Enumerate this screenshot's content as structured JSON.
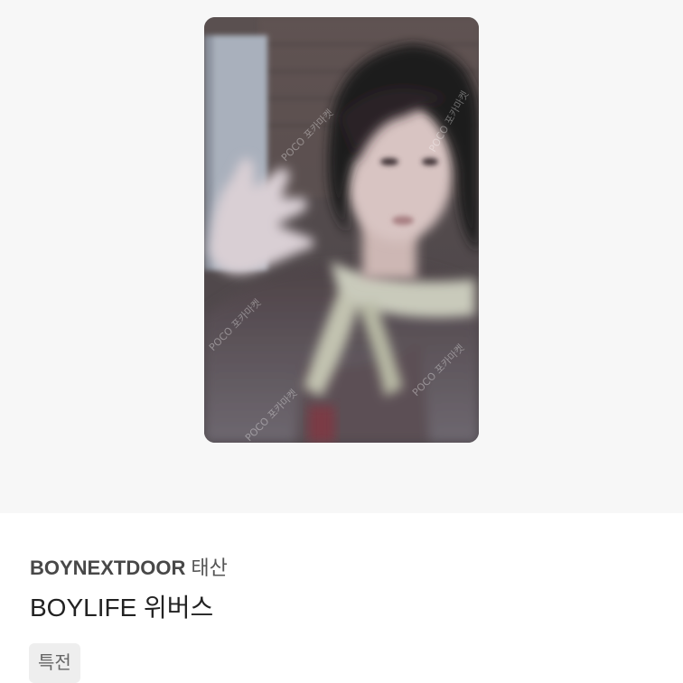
{
  "product": {
    "image_alt": "BOYNEXTDOOR 태산 photocard",
    "watermark_text": "POCO 포카마켓",
    "artist": "BOYNEXTDOOR",
    "member": "태산",
    "title": "BOYLIFE 위버스",
    "tag": "특전"
  },
  "colors": {
    "image_background": "#f7f7f7",
    "tag_background": "#eeeeee",
    "title_text": "#222222",
    "artist_text": "#484848"
  }
}
